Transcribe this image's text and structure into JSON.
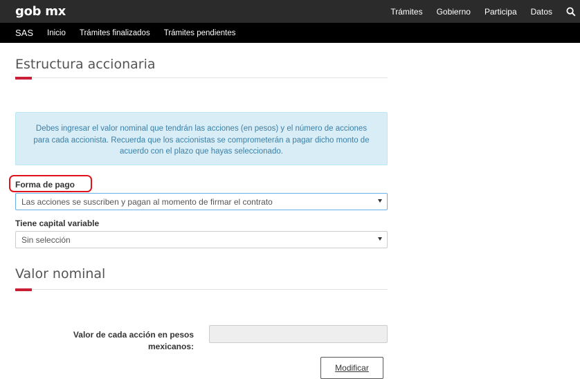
{
  "header": {
    "brand": "gob mx",
    "nav": [
      "Trámites",
      "Gobierno",
      "Participa",
      "Datos"
    ],
    "search_icon": "search-icon"
  },
  "subnav": {
    "app": "SAS",
    "items": [
      "Inicio",
      "Trámites finalizados",
      "Trámites pendientes"
    ]
  },
  "estructura": {
    "title": "Estructura accionaria",
    "alert": "Debes ingresar el valor nominal que tendrán las acciones (en pesos) y el número de acciones para cada accionista. Recuerda que los accionistas se comprometerán a pagar dicho monto de acuerdo con el plazo que hayas seleccionado.",
    "forma_pago_label": "Forma de pago",
    "forma_pago_value": "Las acciones se suscriben y pagan al momento de firmar el contrato",
    "capital_label": "Tiene capital variable",
    "capital_value": "Sin selección"
  },
  "valor_nominal": {
    "title": "Valor nominal",
    "field_label": "Valor de cada acción en pesos mexicanos:",
    "field_value": "",
    "button": "Modificar"
  },
  "colors": {
    "accent": "#c91e36",
    "highlight": "#e0121a",
    "alert_bg": "#d9edf7",
    "alert_text": "#3a7fa5"
  }
}
